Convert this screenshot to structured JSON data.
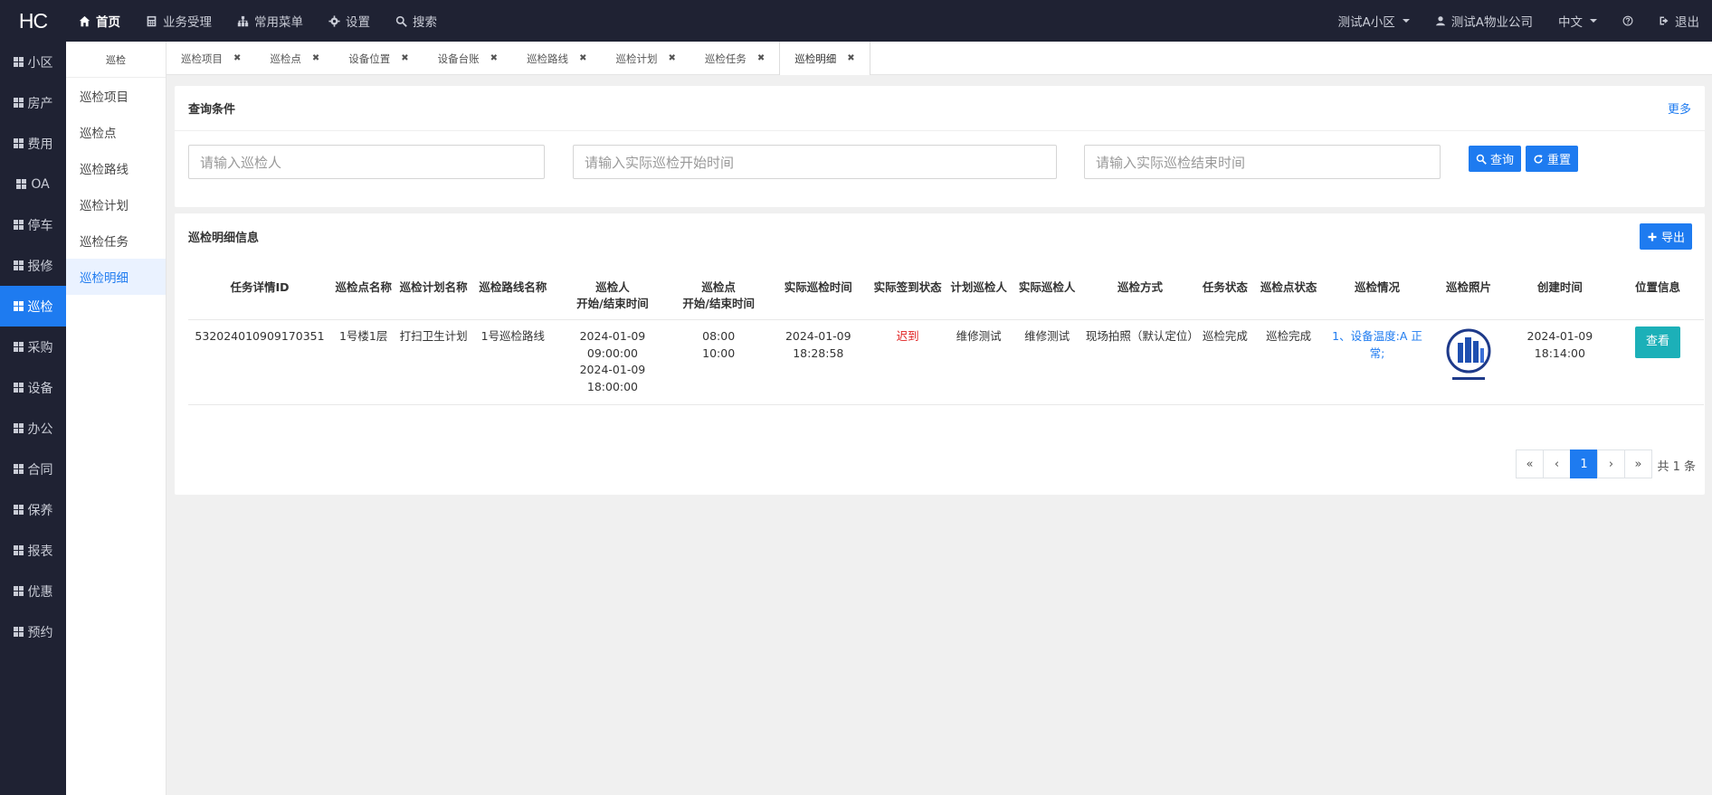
{
  "app": {
    "logo": "HC"
  },
  "topnav": {
    "items": [
      {
        "label": "首页",
        "icon": "home-icon"
      },
      {
        "label": "业务受理",
        "icon": "calculator-icon"
      },
      {
        "label": "常用菜单",
        "icon": "sitemap-icon"
      },
      {
        "label": "设置",
        "icon": "gear-icon"
      },
      {
        "label": "搜索",
        "icon": "search-icon"
      }
    ],
    "right": {
      "community": "测试A小区",
      "company": "测试A物业公司",
      "language": "中文",
      "help_icon": "question-icon",
      "logout": "退出"
    }
  },
  "sidebar": {
    "items": [
      {
        "label": "小区"
      },
      {
        "label": "房产"
      },
      {
        "label": "费用"
      },
      {
        "label": "OA"
      },
      {
        "label": "停车"
      },
      {
        "label": "报修"
      },
      {
        "label": "巡检"
      },
      {
        "label": "采购"
      },
      {
        "label": "设备"
      },
      {
        "label": "办公"
      },
      {
        "label": "合同"
      },
      {
        "label": "保养"
      },
      {
        "label": "报表"
      },
      {
        "label": "优惠"
      },
      {
        "label": "预约"
      }
    ],
    "active": "巡检"
  },
  "submenu": {
    "title": "巡检",
    "items": [
      {
        "label": "巡检项目"
      },
      {
        "label": "巡检点"
      },
      {
        "label": "巡检路线"
      },
      {
        "label": "巡检计划"
      },
      {
        "label": "巡检任务"
      },
      {
        "label": "巡检明细"
      }
    ],
    "active": "巡检明细"
  },
  "tabs": [
    {
      "label": "巡检项目"
    },
    {
      "label": "巡检点"
    },
    {
      "label": "设备位置"
    },
    {
      "label": "设备台账"
    },
    {
      "label": "巡检路线"
    },
    {
      "label": "巡检计划"
    },
    {
      "label": "巡检任务"
    },
    {
      "label": "巡检明细"
    }
  ],
  "query": {
    "title": "查询条件",
    "more": "更多",
    "inspector_placeholder": "请输入巡检人",
    "start_placeholder": "请输入实际巡检开始时间",
    "end_placeholder": "请输入实际巡检结束时间",
    "search_label": "查询",
    "reset_label": "重置"
  },
  "detail": {
    "title": "巡检明细信息",
    "export_label": "导出",
    "columns": [
      "任务详情ID",
      "巡检点名称",
      "巡检计划名称",
      "巡检路线名称",
      "巡检人\n开始/结束时间",
      "巡检点\n开始/结束时间",
      "实际巡检时间",
      "实际签到状态",
      "计划巡检人",
      "实际巡检人",
      "巡检方式",
      "任务状态",
      "巡检点状态",
      "巡检情况",
      "巡检照片",
      "创建时间",
      "位置信息"
    ],
    "rows": [
      {
        "id": "532024010909170351",
        "point_name": "1号楼1层",
        "plan_name": "打扫卫生计划",
        "route_name": "1号巡检路线",
        "inspector_time": "2024-01-09 09:00:00\n2024-01-09 18:00:00",
        "point_time": "08:00\n10:00",
        "actual_time": "2024-01-09\n18:28:58",
        "sign_status": "迟到",
        "plan_inspector": "维修测试",
        "actual_inspector": "维修测试",
        "method": "现场拍照（默认定位）",
        "task_status": "巡检完成",
        "point_status": "巡检完成",
        "situation": "1、设备温度:A 正常;",
        "photo": "building-logo",
        "created": "2024-01-09\n18:14:00",
        "location_btn": "查看"
      }
    ]
  },
  "pagination": {
    "first": "«",
    "prev": "‹",
    "current": "1",
    "next": "›",
    "last": "»",
    "total": "共 1 条"
  },
  "colors": {
    "primary": "#1e7bf0",
    "sidebar_bg": "#1f2233",
    "late": "#e02020",
    "view_btn": "#1cb0b8"
  }
}
